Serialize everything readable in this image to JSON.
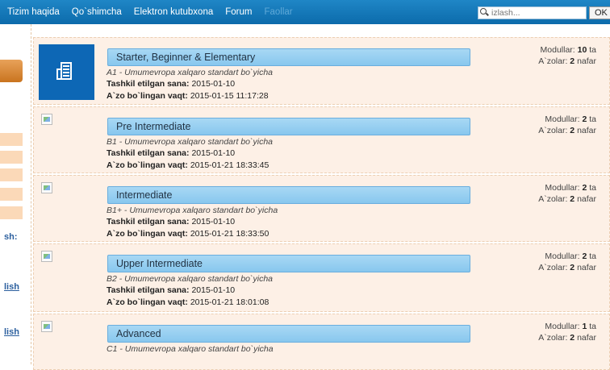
{
  "nav": {
    "items": [
      "Tizim haqida",
      "Qo`shimcha",
      "Elektron kutubxona",
      "Forum",
      "Faollar"
    ],
    "search_placeholder": "izlash...",
    "ok_label": "OK"
  },
  "sidebar": {
    "partial_label": "sh:",
    "links": [
      "lish",
      "lish"
    ]
  },
  "labels": {
    "created": "Tashkil etilgan sana:",
    "joined": "A`zo bo`lingan vaqt:",
    "modules": "Modullar:",
    "modules_unit": "ta",
    "members": "A`zolar:",
    "members_unit": "nafar"
  },
  "courses": [
    {
      "title": "Starter, Beginner & Elementary",
      "level": "A1",
      "desc": " - Umumevropa xalqaro standart bo`yicha",
      "created": "2015-01-10",
      "joined": "2015-01-15 11:17:28",
      "modules": "10",
      "members": "2"
    },
    {
      "title": "Pre Intermediate",
      "level": "B1",
      "desc": " - Umumevropa xalqaro standart bo`yicha",
      "created": "2015-01-10",
      "joined": "2015-01-21 18:33:45",
      "modules": "2",
      "members": "2"
    },
    {
      "title": "Intermediate",
      "level": "B1+",
      "desc": " - Umumevropa xalqaro standart bo`yicha",
      "created": "2015-01-10",
      "joined": "2015-01-21 18:33:50",
      "modules": "2",
      "members": "2"
    },
    {
      "title": "Upper Intermediate",
      "level": "B2",
      "desc": " - Umumevropa xalqaro standart bo`yicha",
      "created": "2015-01-10",
      "joined": "2015-01-21 18:01:08",
      "modules": "2",
      "members": "2"
    },
    {
      "title": "Advanced",
      "level": "C1",
      "desc": " - Umumevropa xalqaro standart bo`yicha",
      "created": "",
      "joined": "",
      "modules": "1",
      "members": "2"
    }
  ],
  "colors": {
    "nav_bg": "#0c6bab",
    "card_bg": "#fdf0e6",
    "title_bg": "#88c7ee",
    "thumb_bg": "#0d67b5"
  }
}
